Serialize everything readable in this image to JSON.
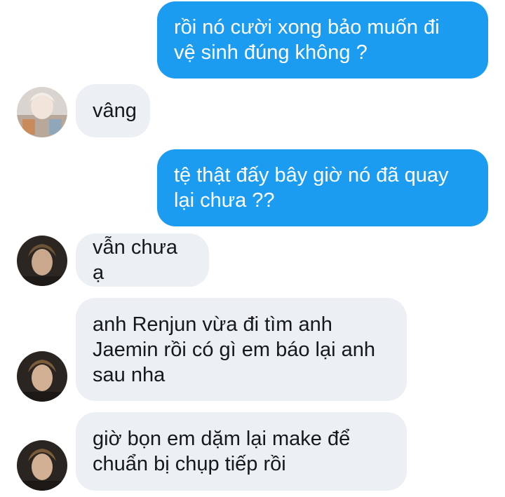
{
  "messages": [
    {
      "sender": "me",
      "text": "rồi nó cười xong bảo muốn đi\nvệ sinh đúng không ?"
    },
    {
      "sender": "them",
      "text": "vâng"
    },
    {
      "sender": "me",
      "text": "tệ thật đấy bây giờ nó đã quay\nlại chưa ??"
    },
    {
      "sender": "them",
      "text": "vẫn chưa ạ"
    },
    {
      "sender": "them",
      "text": "anh Renjun vừa đi tìm anh\nJaemin rồi có gì em báo lại anh\nsau nha"
    },
    {
      "sender": "them",
      "text": "giờ bọn em dặm lại make để\nchuẩn bị chụp tiếp rồi"
    }
  ],
  "colors": {
    "outgoing_bubble": "#1c9cf0",
    "incoming_bubble": "#eceff3"
  }
}
